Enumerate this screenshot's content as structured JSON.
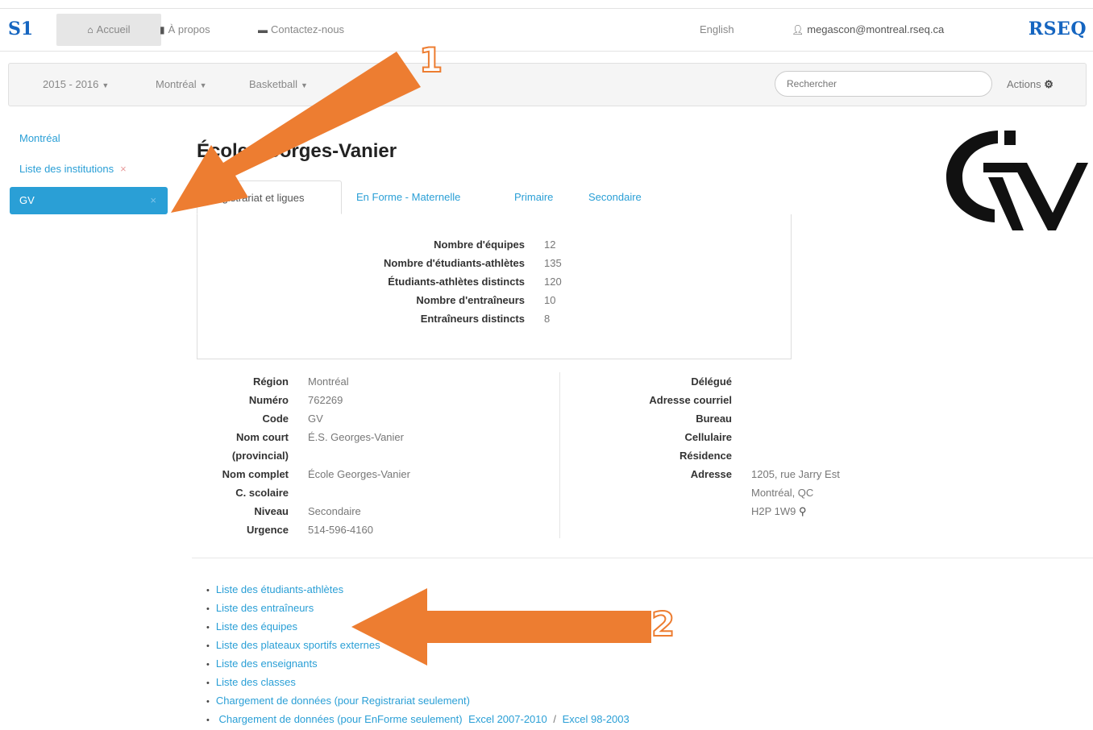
{
  "topbar": {
    "brand": "S1",
    "nav": [
      {
        "label": "Accueil",
        "icon": "home-icon"
      },
      {
        "label": "À propos",
        "icon": "file-icon"
      },
      {
        "label": "Contactez-nous",
        "icon": "comment-icon"
      }
    ],
    "language": "English",
    "user": "megascon@montreal.rseq.ca",
    "logo_text": "RSEQ"
  },
  "subbar": {
    "season": "2015 - 2016",
    "region": "Montréal",
    "sport": "Basketball",
    "search_placeholder": "Rechercher",
    "actions": "Actions"
  },
  "sidebar": {
    "items": [
      {
        "label": "Montréal"
      },
      {
        "label": "Liste des institutions",
        "close": "×"
      },
      {
        "label": "GV",
        "close": "×"
      }
    ]
  },
  "main": {
    "title": "École Georges-Vanier",
    "tabs": [
      {
        "label": "Registrariat et ligues"
      },
      {
        "label": "En Forme - Maternelle"
      },
      {
        "label": "Primaire"
      },
      {
        "label": "Secondaire"
      }
    ],
    "stats": [
      {
        "label": "Nombre d'équipes",
        "value": "12"
      },
      {
        "label": "Nombre d'étudiants-athlètes",
        "value": "135"
      },
      {
        "label": "Étudiants-athlètes distincts",
        "value": "120"
      },
      {
        "label": "Nombre d'entraîneurs",
        "value": "10"
      },
      {
        "label": "Entraîneurs distincts",
        "value": "8"
      }
    ],
    "info_left": [
      {
        "label": "Région",
        "value": "Montréal"
      },
      {
        "label": "Numéro",
        "value": "762269"
      },
      {
        "label": "Code",
        "value": "GV"
      },
      {
        "label": "Nom court",
        "value": "É.S. Georges-Vanier"
      },
      {
        "label": "(provincial)",
        "value": ""
      },
      {
        "label": "Nom complet",
        "value": "École Georges-Vanier"
      },
      {
        "label": "C. scolaire",
        "value": ""
      },
      {
        "label": "Niveau",
        "value": "Secondaire"
      },
      {
        "label": "Urgence",
        "value": "514-596-4160"
      }
    ],
    "info_right": [
      {
        "label": "Délégué",
        "value": ""
      },
      {
        "label": "Adresse courriel",
        "value": ""
      },
      {
        "label": "Bureau",
        "value": ""
      },
      {
        "label": "Cellulaire",
        "value": ""
      },
      {
        "label": "Résidence",
        "value": ""
      },
      {
        "label": "Adresse",
        "value": "1205, rue Jarry Est"
      },
      {
        "label": "",
        "value": "Montréal, QC"
      },
      {
        "label": "",
        "value": "H2P 1W9"
      }
    ],
    "links": [
      {
        "label": "Liste des étudiants-athlètes"
      },
      {
        "label": "Liste des entraîneurs"
      },
      {
        "label": "Liste des équipes"
      },
      {
        "label": "Liste des plateaux sportifs externes"
      },
      {
        "label": "Liste des enseignants"
      },
      {
        "label": "Liste des classes"
      },
      {
        "label": "Chargement de données (pour Registrariat seulement)"
      },
      {
        "label": "Chargement de données (pour EnForme seulement)",
        "excel_new": "Excel 2007-2010",
        "separator": "/",
        "excel_old": "Excel 98-2003"
      }
    ]
  },
  "annotations": {
    "arrow1_label": "1",
    "arrow2_label": "2",
    "color": "#ed7d31"
  }
}
